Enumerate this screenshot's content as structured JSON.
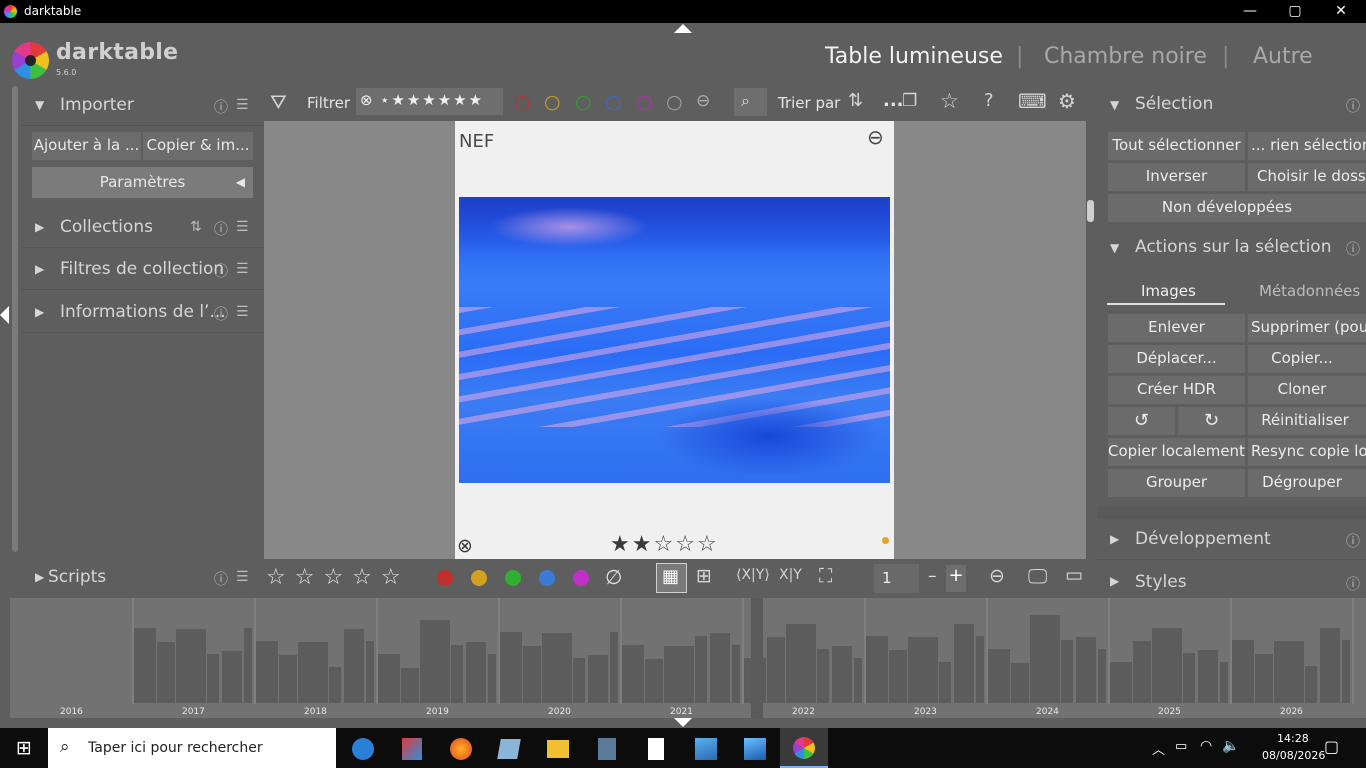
{
  "window": {
    "title": "darktable",
    "minimize": "—",
    "maximize": "▢",
    "close": "✕"
  },
  "app": {
    "name": "darktable",
    "version": "5.6.0"
  },
  "views": {
    "lighttable": "Table lumineuse",
    "darkroom": "Chambre noire",
    "other": "Autre",
    "sep": "|"
  },
  "left": {
    "import": {
      "title": "Importer",
      "add": "Ajouter à la ...",
      "copy": "Copier & im...",
      "params": "Paramètres"
    },
    "collections": "Collections",
    "filters": "Filtres de collection",
    "info": "Informations de l’...",
    "scripts": "Scripts"
  },
  "toolbar": {
    "filter": "Filtrer",
    "sort": "Trier par",
    "more": "..."
  },
  "thumbnail": {
    "format": "NEF",
    "rating": 2
  },
  "right": {
    "selection": {
      "title": "Sélection",
      "select_all": "Tout sélectionner",
      "select_none": "... rien sélectionner",
      "invert": "Inverser",
      "choose_folder": "Choisir le dossier",
      "undeveloped": "Non développées"
    },
    "actions": {
      "title": "Actions sur la sélection",
      "tab_images": "Images",
      "tab_metadata": "Métadonnées",
      "remove": "Enlever",
      "delete": "Supprimer (poubelle)",
      "move": "Déplacer...",
      "copy": "Copier...",
      "hdr": "Créer HDR",
      "duplicate": "Cloner",
      "reset": "Réinitialiser",
      "copy_local": "Copier localement",
      "resync": "Resync copie locale",
      "group": "Grouper",
      "ungroup": "Dégrouper"
    },
    "develop": "Développement",
    "styles": "Styles"
  },
  "bottom": {
    "zoom_value": "1",
    "minus": "–",
    "plus": "+"
  },
  "timeline": {
    "years": [
      "2016",
      "2017",
      "2018",
      "2019",
      "2020",
      "2021",
      "2022",
      "2023",
      "2024",
      "2025",
      "2026"
    ]
  },
  "taskbar": {
    "search_placeholder": "Taper ici pour rechercher",
    "time": "14:28",
    "date": "08/08/2026"
  },
  "colors": {
    "accent_orange": "#f0a020",
    "bg": "#5e5e5e",
    "red": "#c0302a",
    "yellow": "#d4a020",
    "green": "#30b030",
    "blue": "#3a7ad8",
    "purple": "#c030c8"
  }
}
